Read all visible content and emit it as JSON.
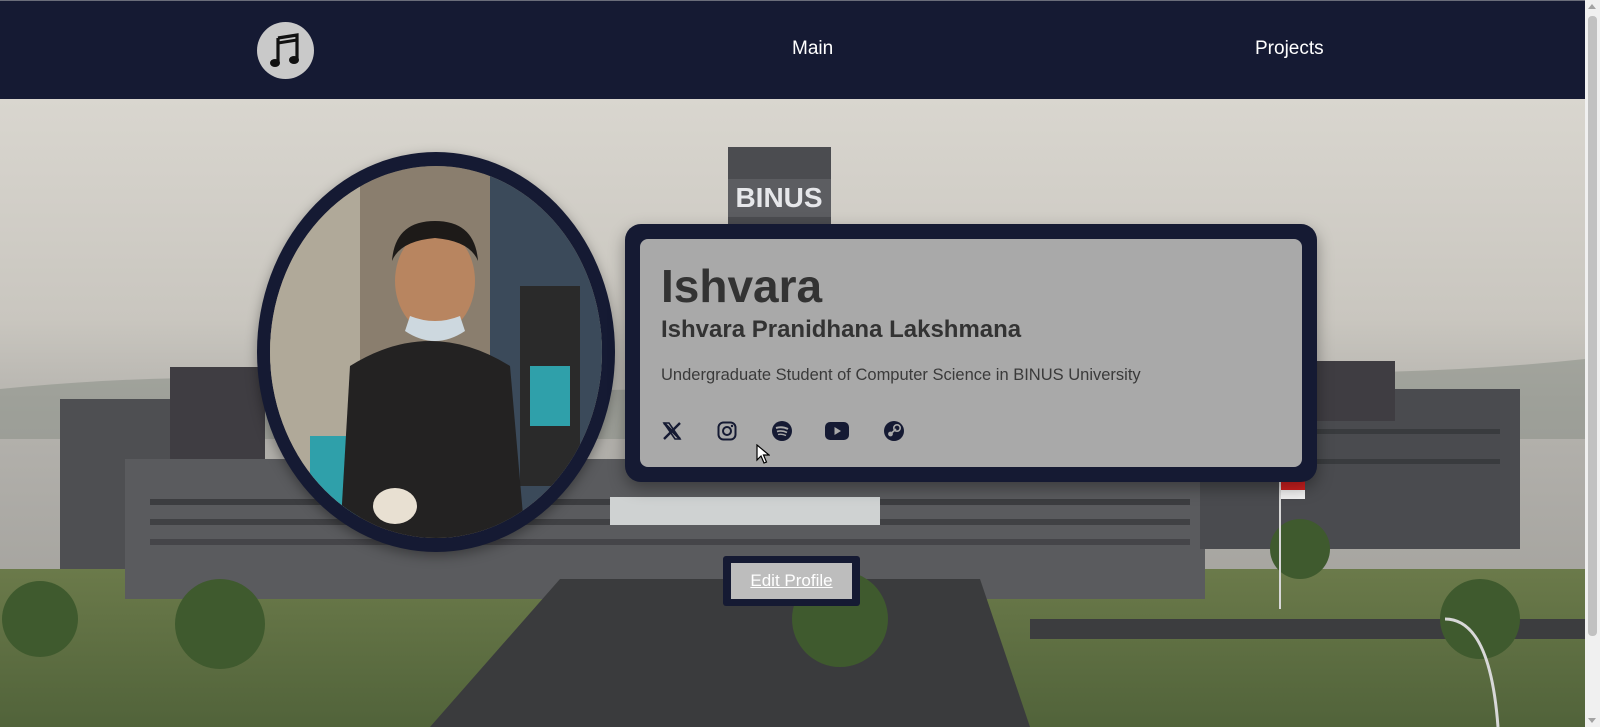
{
  "nav": {
    "logo_icon": "music-note-icon",
    "links": [
      {
        "label": "Main"
      },
      {
        "label": "Projects"
      }
    ]
  },
  "hero": {
    "background": "campus-building-photo",
    "building_sign": "BINUS"
  },
  "profile": {
    "photo": "profile-photo",
    "nickname": "Ishvara",
    "full_name": "Ishvara Pranidhana Lakshmana",
    "bio": "Undergraduate Student of Computer Science in BINUS University",
    "socials": [
      {
        "icon": "x-twitter-icon"
      },
      {
        "icon": "instagram-icon"
      },
      {
        "icon": "spotify-icon"
      },
      {
        "icon": "youtube-icon"
      },
      {
        "icon": "steam-icon"
      }
    ]
  },
  "actions": {
    "edit_label": "Edit Profile"
  },
  "colors": {
    "navy": "#151a33",
    "card": "#a9a9a9",
    "text_dark": "#333333"
  }
}
